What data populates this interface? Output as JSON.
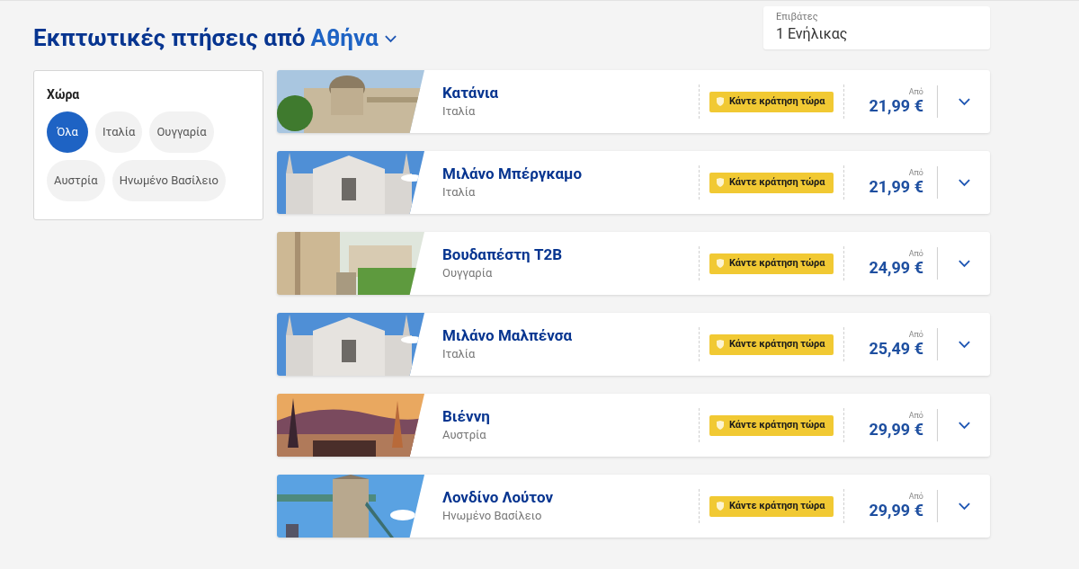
{
  "heading": {
    "text": "Εκπτωτικές πτήσεις από",
    "city": "Αθήνα"
  },
  "passengers": {
    "label": "Επιβάτες",
    "value": "1 Ενήλικας"
  },
  "filter": {
    "title": "Χώρα",
    "options": [
      {
        "label": "Όλα",
        "selected": true
      },
      {
        "label": "Ιταλία",
        "selected": false
      },
      {
        "label": "Ουγγαρία",
        "selected": false
      },
      {
        "label": "Αυστρία",
        "selected": false
      },
      {
        "label": "Ηνωμένο Βασίλειο",
        "selected": false
      }
    ]
  },
  "flights": [
    {
      "city": "Κατάνια",
      "country": "Ιταλία",
      "badge": "Κάντε κράτηση τώρα",
      "from": "Από",
      "price": "21,99 €"
    },
    {
      "city": "Μιλάνο Μπέργκαμο",
      "country": "Ιταλία",
      "badge": "Κάντε κράτηση τώρα",
      "from": "Από",
      "price": "21,99 €"
    },
    {
      "city": "Βουδαπέστη T2B",
      "country": "Ουγγαρία",
      "badge": "Κάντε κράτηση τώρα",
      "from": "Από",
      "price": "24,99 €"
    },
    {
      "city": "Μιλάνο Μαλπένσα",
      "country": "Ιταλία",
      "badge": "Κάντε κράτηση τώρα",
      "from": "Από",
      "price": "25,49 €"
    },
    {
      "city": "Βιέννη",
      "country": "Αυστρία",
      "badge": "Κάντε κράτηση τώρα",
      "from": "Από",
      "price": "29,99 €"
    },
    {
      "city": "Λονδίνο Λούτον",
      "country": "Ηνωμένο Βασίλειο",
      "badge": "Κάντε κράτηση τώρα",
      "from": "Από",
      "price": "29,99 €"
    }
  ]
}
